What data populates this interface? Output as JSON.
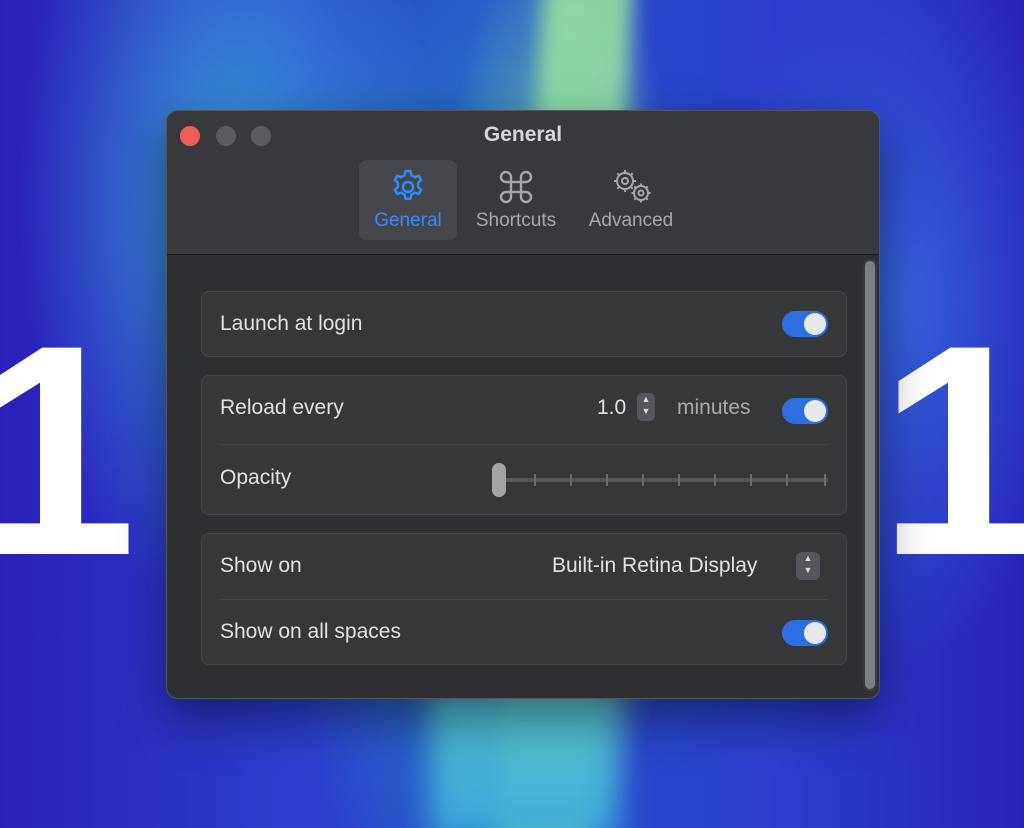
{
  "background": {
    "big_digit_left": "1",
    "big_digit_right": "1"
  },
  "window": {
    "title": "General",
    "tabs": [
      {
        "label": "General",
        "icon": "gear-icon",
        "active": true
      },
      {
        "label": "Shortcuts",
        "icon": "command-icon",
        "active": false
      },
      {
        "label": "Advanced",
        "icon": "gears-icon",
        "active": false
      }
    ]
  },
  "settings": {
    "launch_at_login": {
      "label": "Launch at login",
      "enabled": true
    },
    "reload_every": {
      "label": "Reload every",
      "value": "1.0",
      "unit": "minutes",
      "enabled": true
    },
    "opacity": {
      "label": "Opacity",
      "level": 0
    },
    "show_on": {
      "label": "Show on",
      "value": "Built-in Retina Display"
    },
    "show_on_all_spaces": {
      "label": "Show on all spaces",
      "enabled": true
    }
  },
  "colors": {
    "accent": "#2f8bff",
    "toggle_on": "#2d6fe0",
    "close_button": "#ee5d57"
  }
}
